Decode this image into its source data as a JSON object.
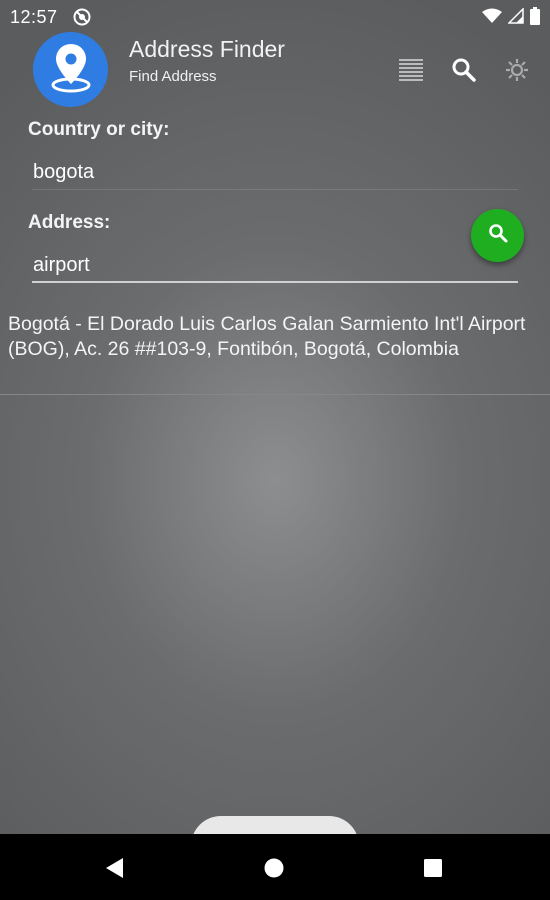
{
  "status_bar": {
    "time": "12:57",
    "icons": [
      "do-not-disturb-icon",
      "wifi-icon",
      "signal-icon",
      "battery-icon"
    ]
  },
  "app": {
    "title": "Address Finder",
    "subtitle": "Find Address",
    "logo_icon": "map-pin-icon",
    "accent_color": "#2f7de3"
  },
  "toolbar": {
    "icons": [
      "list-icon",
      "search-icon",
      "gear-icon"
    ]
  },
  "form": {
    "country_label": "Country or city:",
    "country_value": "bogota",
    "address_label": "Address:",
    "address_value": "airport",
    "search_button_icon": "search-icon",
    "search_button_color": "#1fae1f"
  },
  "results": [
    {
      "text": "Bogotá - El Dorado Luis Carlos Galan Sarmiento Int'l Airport (BOG), Ac. 26 ##103-9, Fontibón, Bogotá, Colombia"
    }
  ],
  "nav_bar": {
    "icons": [
      "back-icon",
      "home-icon",
      "recents-icon"
    ]
  }
}
